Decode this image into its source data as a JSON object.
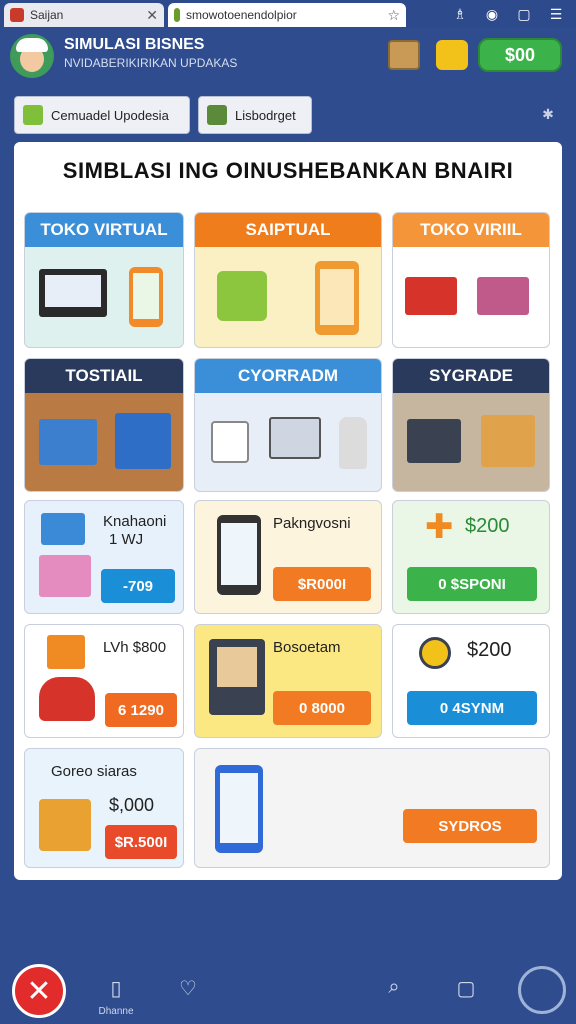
{
  "browser": {
    "tabs": [
      {
        "title": "Saijan"
      },
      {
        "title": "smowotoenendolpior"
      }
    ],
    "window_controls": [
      "extension-icon",
      "profile-icon",
      "maximize-icon",
      "menu-icon"
    ]
  },
  "app": {
    "title": "SIMULASI BISNES",
    "subtitle": "NVIDABERIKIRIKAN UPDAKAS",
    "cash": "$00"
  },
  "toolbar": {
    "btn1": "Cemuadel Upodesia",
    "btn2": "Lisbodrget"
  },
  "panel": {
    "title": "SIMBLASI ING OINUSHEBANKAN BNAIRI"
  },
  "cards_top": [
    {
      "title": "TOKO VIRTUAL",
      "color": "#3a8fd8"
    },
    {
      "title": "SAIPTUAL",
      "color": "#f07d1c"
    },
    {
      "title": "TOKO VIRIIL",
      "color": "#f5953a"
    }
  ],
  "cards_mid": [
    {
      "title": "TOSTIAIL",
      "color": "#2a3a5c"
    },
    {
      "title": "CYORRADM",
      "color": "#3a8fd8"
    },
    {
      "title": "SYGRADE",
      "color": "#2a3a5c"
    }
  ],
  "row3": [
    {
      "text1": "Knahaoni",
      "text2": "1  WJ",
      "button": "-709"
    },
    {
      "text1": "Pakngvosni",
      "button": "$R000I"
    },
    {
      "price": "$200",
      "button": "0 $SPONI"
    }
  ],
  "row4": [
    {
      "text1": "LVh $800",
      "button": "6 1290"
    },
    {
      "text1": "Bosoetam",
      "button": "0 8000"
    },
    {
      "price": "$200",
      "button": "0 4SYNM"
    }
  ],
  "row5": [
    {
      "text1": "Goreo siaras",
      "price": "$,000",
      "button": "$R.500I"
    },
    {
      "button": "SYDROS"
    }
  ],
  "bottom_nav": {
    "label": "Dhanne"
  }
}
